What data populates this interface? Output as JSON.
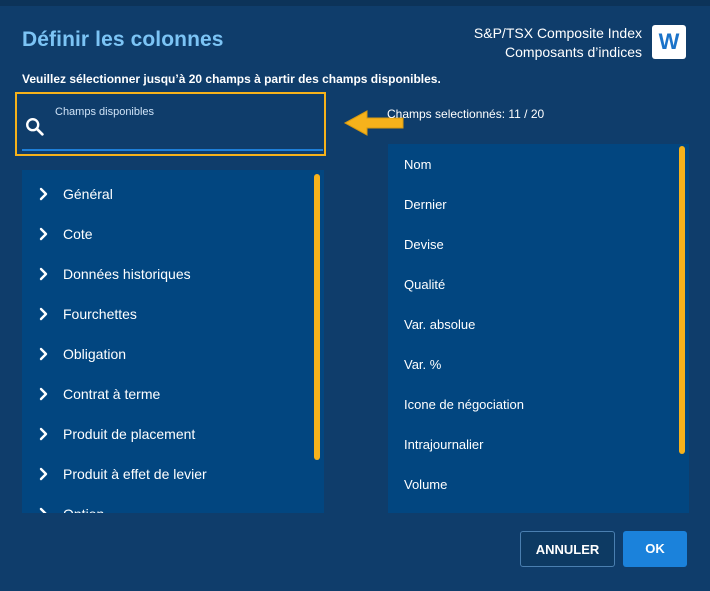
{
  "dialog": {
    "title": "Définir les colonnes",
    "index_name": "S&P/TSX Composite Index",
    "index_subtitle": "Composants d’indices",
    "logo_letter": "W",
    "instruction": "Veuillez sélectionner jusqu’à 20 champs à partir des champs disponibles."
  },
  "search": {
    "label": "Champs disponibles",
    "value": "",
    "icon": "search-icon"
  },
  "selected": {
    "count_label": "Champs selectionnés: 11 / 20"
  },
  "available_groups": [
    {
      "label": "Général"
    },
    {
      "label": "Cote"
    },
    {
      "label": "Données historiques"
    },
    {
      "label": "Fourchettes"
    },
    {
      "label": "Obligation"
    },
    {
      "label": "Contrat à terme"
    },
    {
      "label": "Produit de placement"
    },
    {
      "label": "Produit à effet de levier"
    },
    {
      "label": "Option"
    }
  ],
  "selected_fields": [
    {
      "label": "Nom"
    },
    {
      "label": "Dernier"
    },
    {
      "label": "Devise"
    },
    {
      "label": "Qualité"
    },
    {
      "label": "Var. absolue"
    },
    {
      "label": "Var. %"
    },
    {
      "label": "Icone de négociation"
    },
    {
      "label": "Intrajournalier"
    },
    {
      "label": "Volume"
    }
  ],
  "buttons": {
    "cancel": "ANNULER",
    "ok": "OK"
  },
  "colors": {
    "background": "#0f3d6b",
    "list_background": "#024680",
    "highlight": "#f6b21b",
    "title": "#7cc4f5",
    "accent": "#1b82db"
  }
}
